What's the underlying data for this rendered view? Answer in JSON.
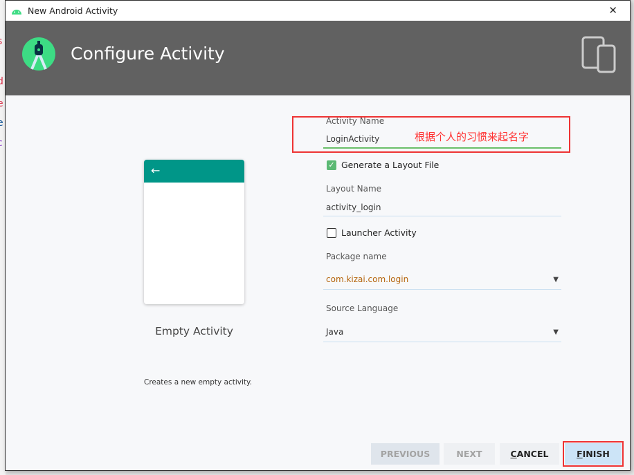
{
  "background": {
    "edge_chars": [
      {
        "c": "s",
        "color": "#d9314a"
      },
      {
        "c": "d",
        "color": "#d9314a"
      },
      {
        "c": "e",
        "color": "#d9314a"
      },
      {
        "c": "e",
        "color": "#1a5a9a"
      },
      {
        "c": "c",
        "color": "#9a5ad0"
      }
    ]
  },
  "window": {
    "title": "New Android Activity",
    "close": "✕"
  },
  "header": {
    "title": "Configure Activity"
  },
  "preview": {
    "back": "←",
    "template_name": "Empty Activity",
    "description": "Creates a new empty activity."
  },
  "form": {
    "activity_name_label": "Activity Name",
    "activity_name": "LoginActivity",
    "generate_layout": {
      "label": "Generate a Layout File",
      "checked": true
    },
    "layout_name_label": "Layout Name",
    "layout_name": "activity_login",
    "launcher": {
      "label": "Launcher Activity",
      "checked": false
    },
    "package_label": "Package name",
    "package": "com.kizai.com.login",
    "language_label": "Source Language",
    "language": "Java"
  },
  "annotation": "根据个人的习惯来起名字",
  "buttons": {
    "previous": "PREVIOUS",
    "next": "NEXT",
    "cancel_first": "C",
    "cancel_rest": "ANCEL",
    "finish_first": "F",
    "finish_rest": "INISH"
  },
  "colors": {
    "header": "#616161",
    "accent": "#009688",
    "highlight": "#ee3333",
    "finish": "#cce4f7"
  }
}
